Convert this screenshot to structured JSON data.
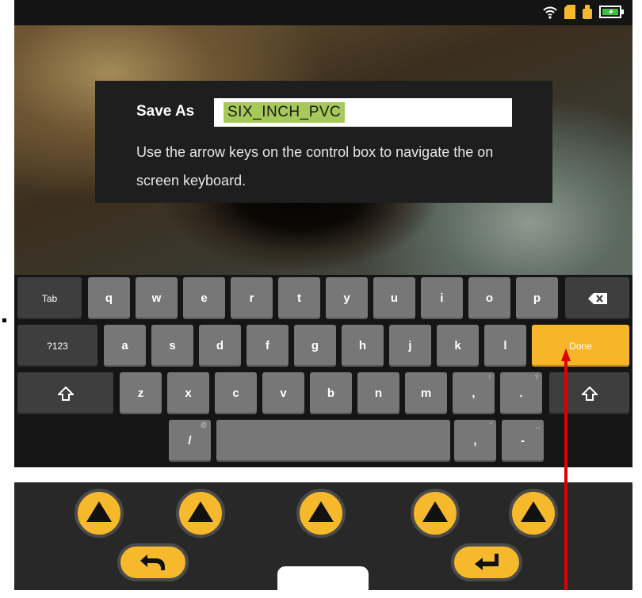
{
  "dialog": {
    "label": "Save As",
    "filename": "SIX_INCH_PVC",
    "instructions": "Use the arrow keys on the control box to navigate the on screen keyboard."
  },
  "keyboard": {
    "row1": [
      "q",
      "w",
      "e",
      "r",
      "t",
      "y",
      "u",
      "i",
      "o",
      "p"
    ],
    "row2": [
      "a",
      "s",
      "d",
      "f",
      "g",
      "h",
      "j",
      "k",
      "l"
    ],
    "row3": [
      "z",
      "x",
      "c",
      "v",
      "b",
      "n",
      "m"
    ],
    "tab_label": "Tab",
    "mode_label": "?123",
    "done_label": "Done",
    "slash_label": "/",
    "slash_alt": "@",
    "comma_label": ",",
    "comma_alt": "!",
    "period_label": ".",
    "period_alt": "?",
    "comma2_label": ",",
    "comma2_alt": "\"",
    "dash_label": "-",
    "dash_alt": "_"
  },
  "status_icons": [
    "wifi-icon",
    "sd-card-icon",
    "usb-drive-icon",
    "battery-icon"
  ],
  "control_box": {
    "buttons": [
      "up-arrow-icon",
      "up-arrow-icon",
      "up-arrow-icon",
      "up-arrow-icon",
      "up-arrow-icon"
    ],
    "back_icon": "back-icon",
    "enter_icon": "enter-icon"
  },
  "colors": {
    "done_key": "#f7b52a",
    "filename_highlight": "#a7c95a",
    "control_buttons": "#f6b92c",
    "annotation_arrow": "#e00000"
  }
}
